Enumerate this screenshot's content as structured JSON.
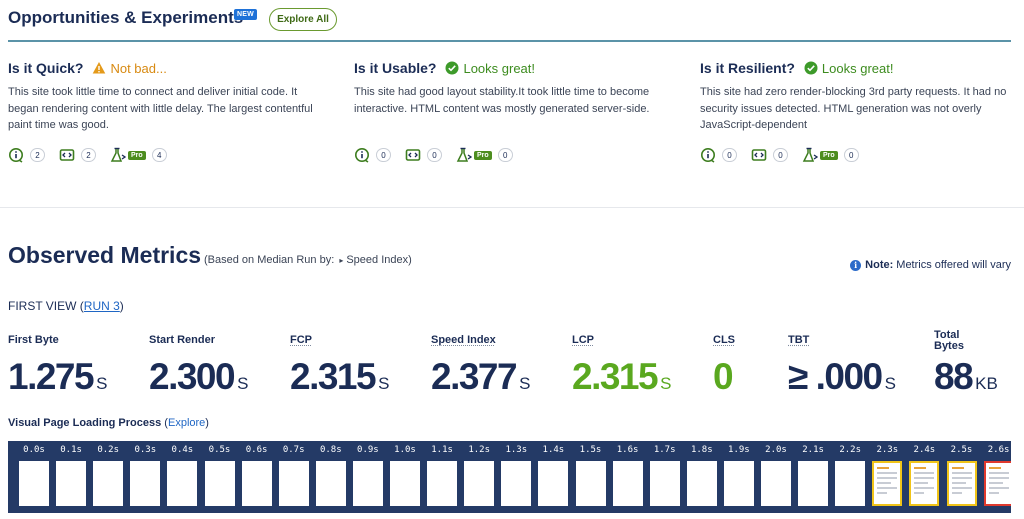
{
  "opportunities": {
    "title": "Opportunities & Experiments",
    "badge": "NEW",
    "explore_all": "Explore All"
  },
  "columns": [
    {
      "question": "Is it Quick?",
      "status": "Not bad...",
      "status_type": "warning",
      "description": "This site took little time to connect and deliver initial code. It began rendering content with little delay. The largest contentful paint time was good.",
      "counts": {
        "insights": "2",
        "experiments": "2",
        "pro": "4"
      }
    },
    {
      "question": "Is it Usable?",
      "status": "Looks great!",
      "status_type": "good",
      "description": "This site had good layout stability.It took little time to become interactive. HTML content was mostly generated server-side.",
      "counts": {
        "insights": "0",
        "experiments": "0",
        "pro": "0"
      }
    },
    {
      "question": "Is it Resilient?",
      "status": "Looks great!",
      "status_type": "good",
      "description": "This site had zero render-blocking 3rd party requests. It had no security issues detected. HTML generation was not overly JavaScript-dependent",
      "counts": {
        "insights": "0",
        "experiments": "0",
        "pro": "0"
      }
    }
  ],
  "pro_label": "Pro",
  "observed": {
    "title": "Observed Metrics",
    "subtitle_prefix": "(Based on Median Run by:",
    "subtitle_metric": "Speed Index)",
    "note_label": "Note:",
    "note_text": "Metrics offered will vary"
  },
  "first_view": {
    "label": "FIRST VIEW (",
    "run_link": "RUN 3",
    "close": ")"
  },
  "metrics": [
    {
      "label": "First Byte",
      "value": "1.275",
      "unit": "S"
    },
    {
      "label": "Start Render",
      "value": "2.300",
      "unit": "S"
    },
    {
      "label": "FCP",
      "value": "2.315",
      "unit": "S"
    },
    {
      "label": "Speed Index",
      "value": "2.377",
      "unit": "S"
    },
    {
      "label": "LCP",
      "value": "2.315",
      "unit": "S"
    },
    {
      "label": "CLS",
      "value": "0",
      "unit": ""
    },
    {
      "label": "TBT",
      "value": "≥ .000",
      "unit": "S"
    },
    {
      "label": "Total Bytes",
      "value": "88",
      "unit": "KB"
    }
  ],
  "total_bytes_label_line1": "Total",
  "total_bytes_label_line2": "Bytes",
  "visual_loading": {
    "label": "Visual Page Loading Process",
    "open": " (",
    "link": "Explore",
    "close": ")"
  },
  "filmstrip": {
    "frames": [
      "0.0s",
      "0.1s",
      "0.2s",
      "0.3s",
      "0.4s",
      "0.5s",
      "0.6s",
      "0.7s",
      "0.8s",
      "0.9s",
      "1.0s",
      "1.1s",
      "1.2s",
      "1.3s",
      "1.4s",
      "1.5s",
      "1.6s",
      "1.7s",
      "1.8s",
      "1.9s",
      "2.0s",
      "2.1s",
      "2.2s",
      "2.3s",
      "2.4s",
      "2.5s",
      "2.6s"
    ],
    "first_visual_index": 23,
    "lcp_index": 26
  },
  "colors": {
    "navy": "#1b2c55",
    "green": "#5aa81f",
    "warning": "#d88a12",
    "filmstrip_bg": "#243a66",
    "link": "#1f66c4"
  }
}
